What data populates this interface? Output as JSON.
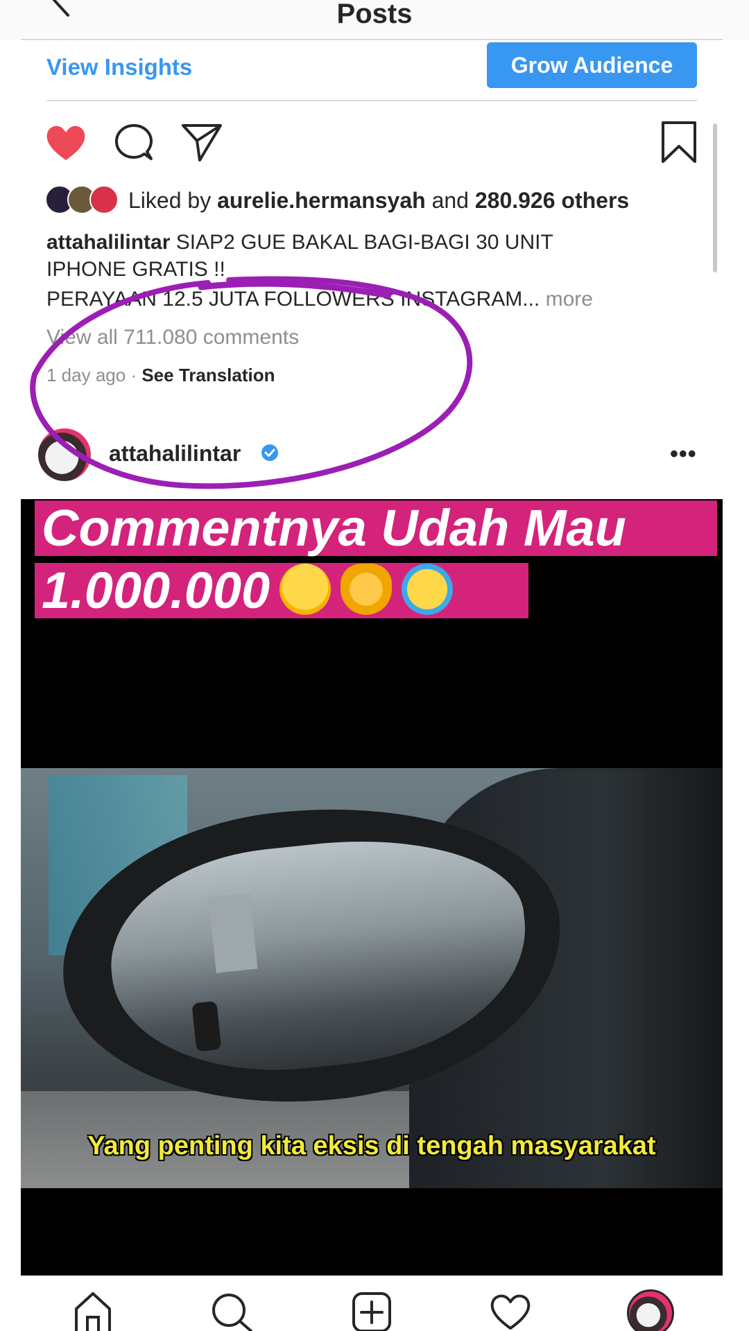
{
  "header": {
    "title": "Posts"
  },
  "insights": {
    "view_insights_label": "View Insights",
    "grow_audience_label": "Grow Audience"
  },
  "likes": {
    "prefix": "Liked by ",
    "user": "aurelie.hermansyah",
    "middle": " and ",
    "others": "280.926 others"
  },
  "caption": {
    "user": "attahalilintar",
    "line1": " SIAP2 GUE BAKAL BAGI-BAGI 30 UNIT",
    "line2": "IPHONE GRATIS !!",
    "line3": "PERAYAAN 12.5 JUTA FOLLOWERS INSTAGRAM... ",
    "more": "more"
  },
  "comments": {
    "view_all": "View all 711.080 comments"
  },
  "meta": {
    "time": "1 day ago",
    "separator": " · ",
    "see_translation": "See Translation"
  },
  "post": {
    "username": "attahalilintar",
    "more_dots": "•••"
  },
  "media": {
    "overlay_line1": "Commentnya Udah Mau",
    "overlay_line2": "1.000.000",
    "subtitle": "Yang penting kita eksis di tengah masyarakat"
  },
  "icons": {
    "like": "heart-filled-icon",
    "comment": "comment-icon",
    "share": "paper-plane-icon",
    "save": "bookmark-icon",
    "verified": "verified-badge-icon",
    "nav": [
      "home-icon",
      "search-icon",
      "add-post-icon",
      "activity-heart-icon",
      "profile-avatar"
    ]
  },
  "colors": {
    "accent_blue": "#3897f0",
    "like_red": "#ed4956",
    "annotation_purple": "#9b1fb5",
    "overlay_pink": "#d4237b"
  }
}
